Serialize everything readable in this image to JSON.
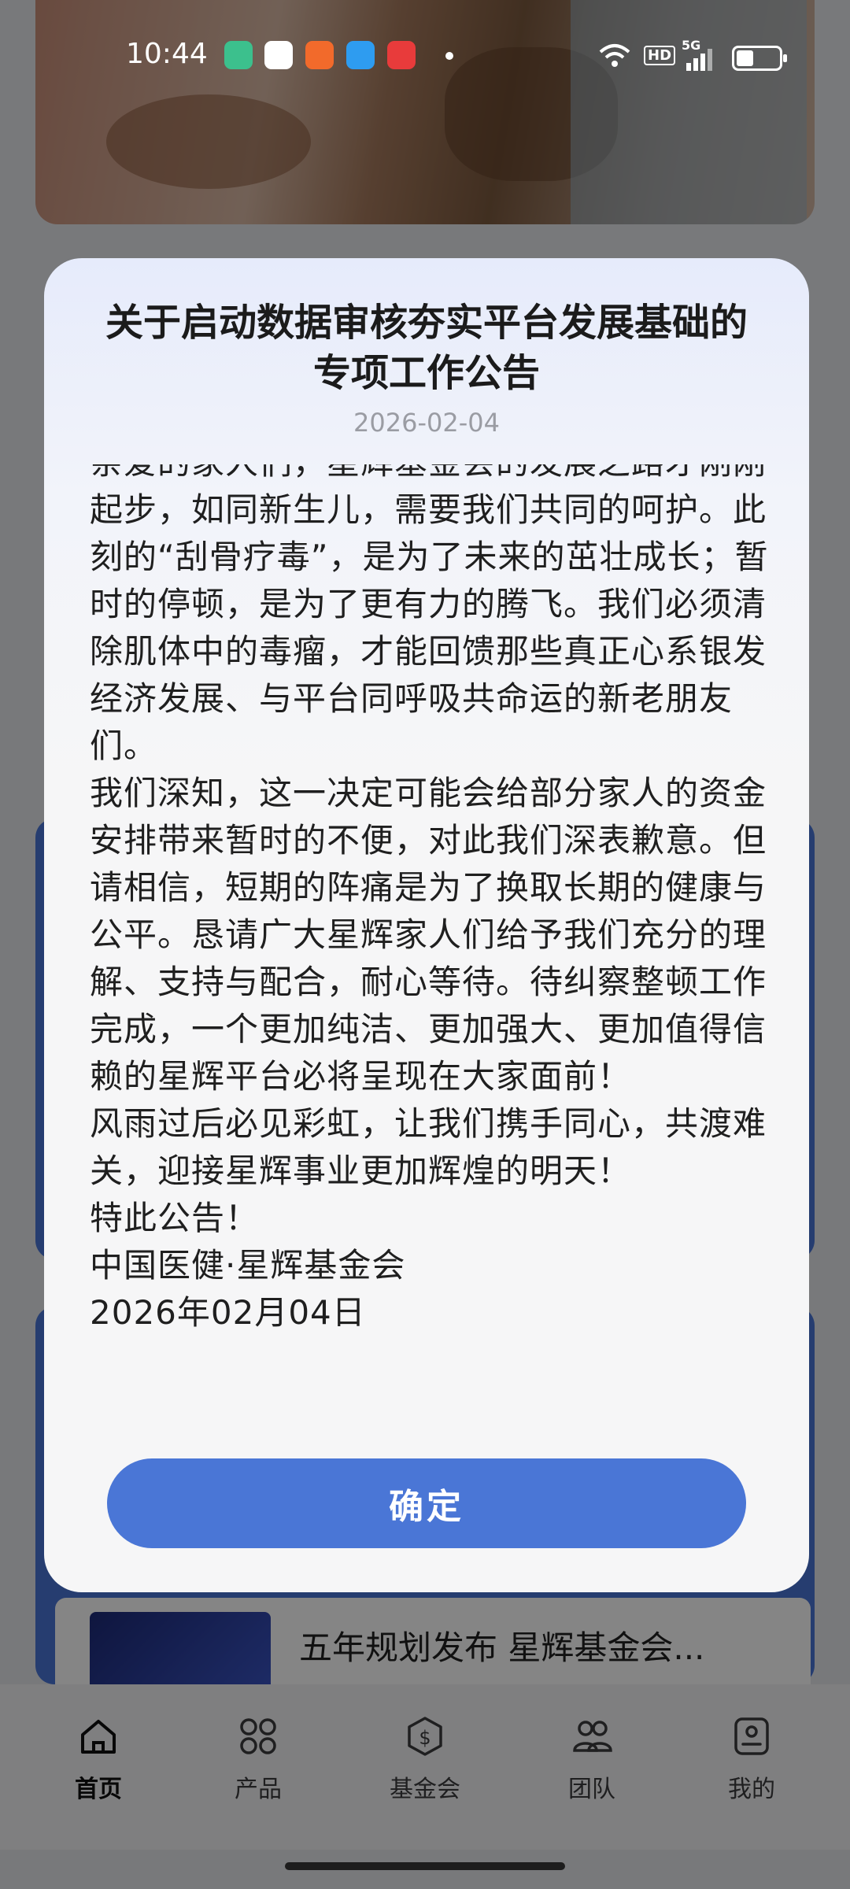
{
  "status_bar": {
    "time": "10:44",
    "app_icons": [
      {
        "name": "shield-app-icon",
        "color": "#3cc08d"
      },
      {
        "name": "oppo-app-icon",
        "color": "#ffffff"
      },
      {
        "name": "orange-app-icon",
        "color": "#f26a2b"
      },
      {
        "name": "wallet-app-icon",
        "color": "#2e9cf0"
      },
      {
        "name": "red-envelope-app-icon",
        "color": "#e83b3b"
      }
    ],
    "hd": "HD",
    "network": "5G",
    "battery_level": 0.4
  },
  "background": {
    "news_title": "五年规划发布 星辉基金会..."
  },
  "modal": {
    "title_line1": "关于启动数据审核夯实平台发展基础的",
    "title_line2": "专项工作公告",
    "date": "2026-02-04",
    "paragraphs": [
      "亲爱的家人们，星辉基金会的发展之路才刚刚起步，如同新生儿，需要我们共同的呵护。此刻的“刮骨疗毒”，是为了未来的茁壮成长；暂时的停顿，是为了更有力的腾飞。我们必须清除肌体中的毒瘤，才能回馈那些真正心系银发经济发展、与平台同呼吸共命运的新老朋友们。",
      "我们深知，这一决定可能会给部分家人的资金安排带来暂时的不便，对此我们深表歉意。但请相信，短期的阵痛是为了换取长期的健康与公平。恳请广大星辉家人们给予我们充分的理解、支持与配合，耐心等待。待纠察整顿工作完成，一个更加纯洁、更加强大、更加值得信赖的星辉平台必将呈现在大家面前！",
      "风雨过后必见彩虹，让我们携手同心，共渡难关，迎接星辉事业更加辉煌的明天！",
      "特此公告！",
      "中国医健·星辉基金会",
      "2026年02月04日"
    ],
    "confirm_label": "确定",
    "accent": "#4a76d6"
  },
  "nav": {
    "items": [
      {
        "label": "首页",
        "icon": "home-icon",
        "active": true
      },
      {
        "label": "产品",
        "icon": "grid-icon",
        "active": false
      },
      {
        "label": "基金会",
        "icon": "dollar-shield-icon",
        "active": false
      },
      {
        "label": "团队",
        "icon": "team-icon",
        "active": false
      },
      {
        "label": "我的",
        "icon": "profile-icon",
        "active": false
      }
    ]
  }
}
